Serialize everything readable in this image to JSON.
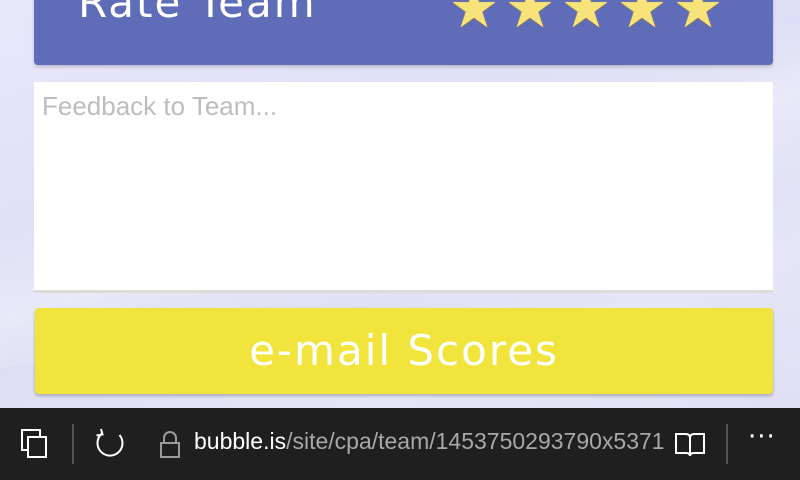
{
  "rating": {
    "title": "Rate Team",
    "stars": [
      "★",
      "★",
      "★",
      "★",
      "★"
    ],
    "filled_count": 5,
    "star_color": "#f8e27a",
    "bar_color": "#5f6db8"
  },
  "feedback": {
    "placeholder": "Feedback to Team...",
    "value": ""
  },
  "email_button": {
    "label": "e-mail Scores",
    "color": "#f1e43d"
  },
  "browser": {
    "url_host": "bubble.is",
    "url_path": "/site/cpa/team/1453750293790x5371",
    "icons": [
      "tabs-icon",
      "refresh-icon",
      "lock-icon",
      "reading-view-icon",
      "more-icon"
    ],
    "more_label": "···"
  }
}
